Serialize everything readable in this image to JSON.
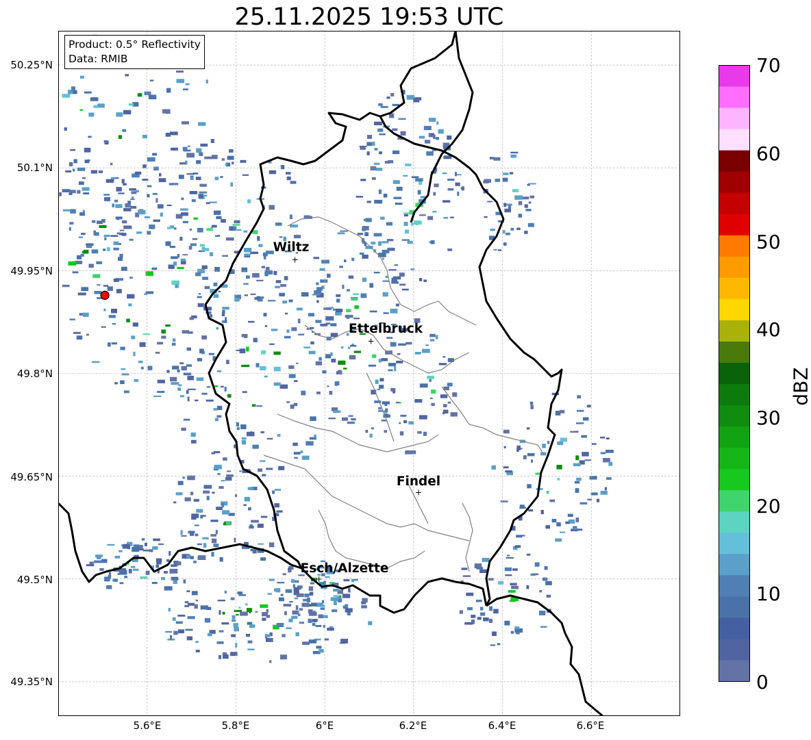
{
  "title": "25.11.2025 19:53 UTC",
  "info_box": {
    "product": "Product: 0.5° Reflectivity",
    "data": "Data: RMIB"
  },
  "map": {
    "lon_range": [
      5.4,
      6.8
    ],
    "lat_range": [
      49.3,
      50.3
    ],
    "lat_ticks": [
      "50.25°N",
      "50.1°N",
      "49.95°N",
      "49.8°N",
      "49.65°N",
      "49.5°N",
      "49.35°N"
    ],
    "lon_ticks": [
      "5.6°E",
      "5.8°E",
      "6°E",
      "6.2°E",
      "6.4°E",
      "6.6°E"
    ],
    "grid": true,
    "radar_site": {
      "lon": 5.505,
      "lat": 49.914,
      "color": "#ff0000"
    },
    "cities": [
      {
        "name": "Wiltz",
        "lon": 5.933,
        "lat": 49.966
      },
      {
        "name": "Ettelbruck",
        "lon": 6.104,
        "lat": 49.847
      },
      {
        "name": "Findel",
        "lon": 6.211,
        "lat": 49.626
      },
      {
        "name": "Esch/Alzette",
        "lon": 5.987,
        "lat": 49.5
      }
    ]
  },
  "colorbar": {
    "label": "dBZ",
    "min": 0,
    "max": 70,
    "step": 2.5,
    "ticks": [
      "0",
      "10",
      "20",
      "30",
      "40",
      "50",
      "60",
      "70"
    ],
    "colors": [
      "#6373a6",
      "#5065a0",
      "#4560a2",
      "#4b72a8",
      "#4f7fb3",
      "#5aa0c8",
      "#64bfdb",
      "#5dd4c0",
      "#3fd46e",
      "#17c81f",
      "#16b617",
      "#11a311",
      "#0e8d0e",
      "#0c7a0c",
      "#0a620a",
      "#4a7a0a",
      "#a9b20a",
      "#ffd800",
      "#ffb800",
      "#ff9a00",
      "#ff7a00",
      "#e00000",
      "#c40000",
      "#9e0000",
      "#7a0000",
      "#ffe0ff",
      "#ffb4ff",
      "#ff6eff",
      "#e83ae8"
    ]
  }
}
